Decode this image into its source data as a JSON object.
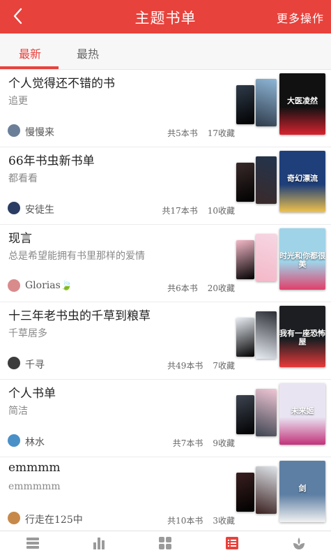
{
  "header": {
    "title": "主题书单",
    "more_label": "更多操作"
  },
  "tabs": [
    {
      "label": "最新"
    },
    {
      "label": "最热"
    }
  ],
  "items": [
    {
      "title": "个人觉得还不错的书",
      "desc": "追更",
      "author": "慢慢来",
      "book_count": "共5本书",
      "favorites": "17收藏",
      "cover_text": "大医凌然",
      "avatar_color": "#6b7f99",
      "colors": {
        "back": "#2f3b4a",
        "mid": "#8fb7d8",
        "front": "#111111",
        "accent": "#d8232f"
      }
    },
    {
      "title": "66年书虫新书单",
      "desc": "都看看",
      "author": "安徒生",
      "book_count": "共17本书",
      "favorites": "10收藏",
      "cover_text": "奇幻漂流",
      "avatar_color": "#2b3d63",
      "colors": {
        "back": "#3a2a2a",
        "mid": "#23344d",
        "front": "#1f3f7a",
        "accent": "#f0c24b"
      }
    },
    {
      "title": "现言",
      "desc": "总是希望能拥有书里那样的爱情",
      "author": "Glorias🍃",
      "book_count": "共6本书",
      "favorites": "20收藏",
      "cover_text": "时光和你都很美",
      "avatar_color": "#d98b8b",
      "colors": {
        "back": "#f3b8c8",
        "mid": "#f7d6e3",
        "front": "#9fd3e8",
        "accent": "#e0406a"
      }
    },
    {
      "title": "十三年老书虫的千草到粮草",
      "desc": "千草居多",
      "author": "千寻",
      "book_count": "共49本书",
      "favorites": "7收藏",
      "cover_text": "我有一座恐怖屋",
      "avatar_color": "#3c3c3c",
      "colors": {
        "back": "#e9eef4",
        "mid": "#2a2d33",
        "front": "#1c1e22",
        "accent": "#e83a3a"
      }
    },
    {
      "title": "个人书单",
      "desc": "简洁",
      "author": "林水",
      "book_count": "共7本书",
      "favorites": "9收藏",
      "cover_text": "未来姬",
      "avatar_color": "#4a90c8",
      "colors": {
        "back": "#3d4450",
        "mid": "#f1c7d6",
        "front": "#e9e4f2",
        "accent": "#c2337a"
      }
    },
    {
      "title": "emmmm",
      "desc": "emmmmm",
      "author": "行走在125中",
      "book_count": "共10本书",
      "favorites": "3收藏",
      "cover_text": "剑",
      "avatar_color": "#c7894a",
      "colors": {
        "back": "#3a1f1f",
        "mid": "#dfe5ea",
        "front": "#5d7fa3",
        "accent": "#f2f2f2"
      }
    }
  ],
  "bottom_nav": [
    {
      "icon": "bookshelf-icon"
    },
    {
      "icon": "ranking-icon"
    },
    {
      "icon": "category-icon"
    },
    {
      "icon": "booklist-icon"
    },
    {
      "icon": "discover-icon"
    }
  ],
  "theme": {
    "accent": "#e8423c"
  }
}
